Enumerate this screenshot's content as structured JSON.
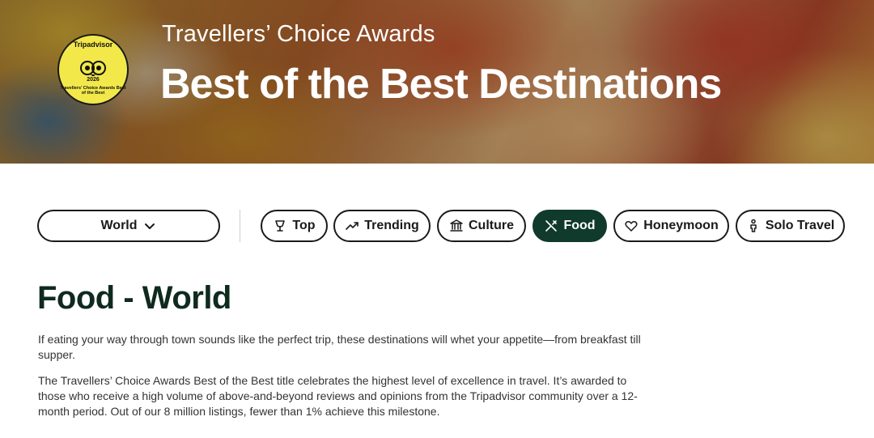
{
  "hero": {
    "subtitle": "Travellers’ Choice Awards",
    "title": "Best of the Best Destinations",
    "badge": {
      "brand": "Tripadvisor",
      "year": "2026",
      "ring_text": "Travellers’ Choice Awards Best of the Best"
    }
  },
  "filters": {
    "region": {
      "label": "World",
      "icon": "chevron-down-icon"
    },
    "categories": [
      {
        "label": "Top",
        "icon": "trophy-icon",
        "active": false
      },
      {
        "label": "Trending",
        "icon": "trending-up-icon",
        "active": false
      },
      {
        "label": "Culture",
        "icon": "museum-icon",
        "active": false
      },
      {
        "label": "Food",
        "icon": "fork-knife-icon",
        "active": true
      },
      {
        "label": "Honeymoon",
        "icon": "hearts-icon",
        "active": false
      },
      {
        "label": "Solo Travel",
        "icon": "person-icon",
        "active": false
      }
    ]
  },
  "content": {
    "heading": "Food - World",
    "intro": "If eating your way through town sounds like the perfect trip, these destinations will whet your appetite—from breakfast till supper.",
    "description": "The Travellers’ Choice Awards Best of the Best title celebrates the highest level of excellence in travel. It’s awarded to those who receive a high volume of above-and-beyond reviews and opinions from the Tripadvisor community over a 12-month period. Out of our 8 million listings, fewer than 1% achieve this milestone."
  },
  "colors": {
    "active_pill": "#0f3a2c",
    "heading": "#0f2a1f",
    "badge": "#f2e84a"
  }
}
